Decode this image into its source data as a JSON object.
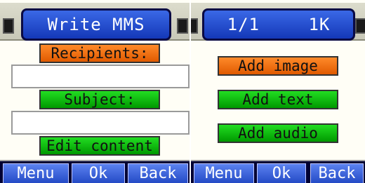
{
  "left_screen": {
    "title": "Write MMS",
    "recipients_label": "Recipients:",
    "recipients_value": "",
    "subject_label": "Subject:",
    "subject_value": "",
    "edit_content_label": "Edit content",
    "softkeys": {
      "menu": "Menu",
      "ok": "Ok",
      "back": "Back"
    }
  },
  "right_screen": {
    "page": "1/1",
    "size": "1K",
    "actions": {
      "add_image": "Add image",
      "add_text": "Add text",
      "add_audio": "Add audio"
    },
    "softkeys": {
      "menu": "Menu",
      "ok": "Ok",
      "back": "Back"
    }
  },
  "colors": {
    "title_pill": "#1f4fd8",
    "selected_item": "#f07010",
    "normal_item": "#10c010",
    "softkey": "#3a63dc"
  }
}
